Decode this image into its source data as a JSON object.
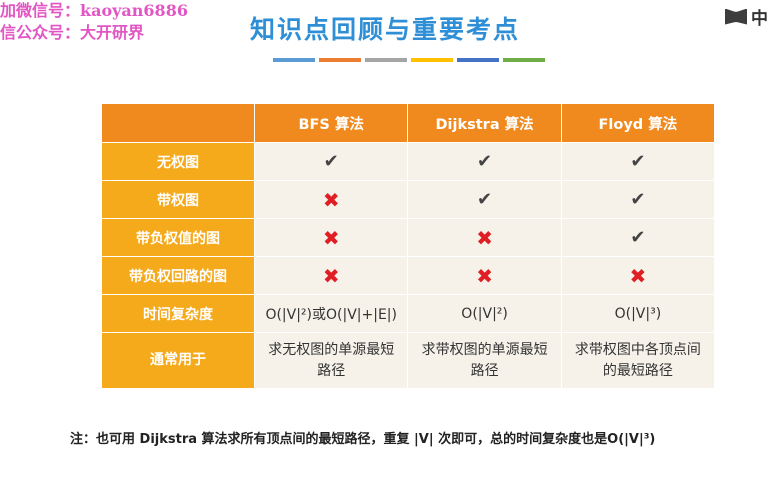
{
  "watermark": {
    "line1": "加微信号：kaoyan6886",
    "line2": "信公众号：大开研界"
  },
  "title": "知识点回顾与重要考点",
  "color_bar": [
    "#5b9bd5",
    "#ed7d31",
    "#a5a5a5",
    "#ffc000",
    "#4472c4",
    "#70ad47"
  ],
  "lang_badge": {
    "icon": "book-icon",
    "label": "中"
  },
  "table": {
    "headers": [
      "",
      "BFS 算法",
      "Dijkstra 算法",
      "Floyd 算法"
    ],
    "rows": [
      {
        "label": "无权图",
        "bfs": "✔",
        "dijkstra": "✔",
        "floyd": "✔"
      },
      {
        "label": "带权图",
        "bfs": "✖",
        "dijkstra": "✔",
        "floyd": "✔"
      },
      {
        "label": "带负权值的图",
        "bfs": "✖",
        "dijkstra": "✖",
        "floyd": "✔"
      },
      {
        "label": "带负权回路的图",
        "bfs": "✖",
        "dijkstra": "✖",
        "floyd": "✖"
      },
      {
        "label": "时间复杂度",
        "bfs": "O(|V|²)或O(|V|+|E|)",
        "dijkstra": "O(|V|²)",
        "floyd": "O(|V|³)"
      },
      {
        "label": "通常用于",
        "bfs": "求无权图的单源最短路径",
        "dijkstra": "求带权图的单源最短路径",
        "floyd": "求带权图中各顶点间的最短路径"
      }
    ]
  },
  "note": "注：也可用 Dijkstra 算法求所有顶点间的最短路径，重复 |V| 次即可，总的时间复杂度也是O(|V|³)"
}
